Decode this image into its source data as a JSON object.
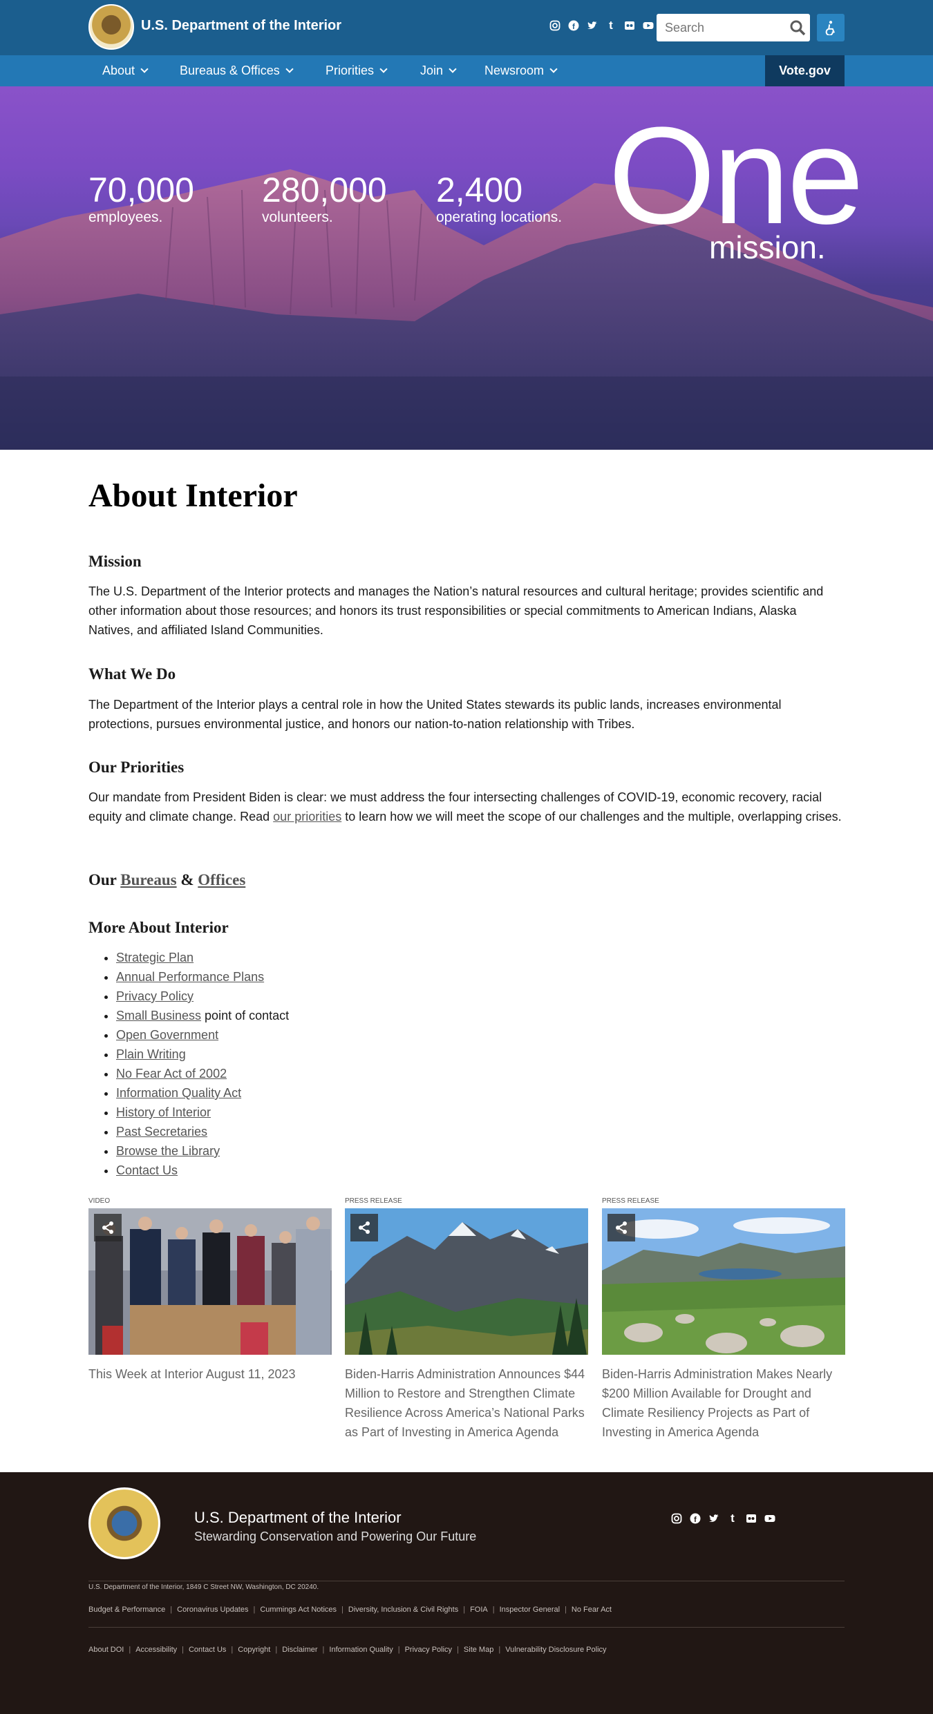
{
  "header": {
    "agency": "U.S. Department of the Interior",
    "search_placeholder": "Search",
    "social": [
      "instagram-icon",
      "facebook-icon",
      "twitter-icon",
      "tumblr-icon",
      "flickr-icon",
      "youtube-icon"
    ]
  },
  "nav": {
    "items": [
      "About",
      "Bureaus & Offices",
      "Priorities",
      "Join",
      "Newsroom"
    ],
    "vote": "Vote.gov"
  },
  "hero": {
    "stats": [
      {
        "num": "70,000",
        "label": "employees."
      },
      {
        "num": "280,000",
        "label": "volunteers."
      },
      {
        "num": "2,400",
        "label": "operating locations."
      }
    ],
    "one": "One",
    "mission": "mission."
  },
  "content": {
    "title": "About Interior",
    "mission_heading": "Mission",
    "mission_text": "The U.S. Department of the Interior protects and manages the Nation’s natural resources and cultural heritage; provides scientific and other information about those resources; and honors its trust responsibilities or special commitments to American Indians, Alaska Natives, and affiliated Island Communities.",
    "whatwedo_heading": "What We Do",
    "whatwedo_text": "The Department of the Interior plays a central role in how the United States stewards its public lands, increases environmental protections, pursues environmental justice, and honors our nation-to-nation relationship with Tribes.",
    "priorities_heading": "Our Priorities",
    "priorities_text_before": "Our mandate from President Biden is clear: we must address the four intersecting challenges of COVID-19, economic recovery, racial equity and climate change. Read ",
    "priorities_link": "our priorities",
    "priorities_text_after": " to learn how we will meet the scope of our challenges and the multiple, overlapping crises.",
    "bureaus_prefix": "Our ",
    "bureaus_link": "Bureaus",
    "bureaus_amp": " & ",
    "offices_link": "Offices",
    "more_heading": "More About Interior",
    "more_links": [
      {
        "link": "Strategic Plan",
        "suffix": ""
      },
      {
        "link": "Annual Performance Plans",
        "suffix": ""
      },
      {
        "link": "Privacy Policy",
        "suffix": ""
      },
      {
        "link": "Small Business",
        "suffix": " point of contact"
      },
      {
        "link": "Open Government",
        "suffix": ""
      },
      {
        "link": "Plain Writing ",
        "suffix": ""
      },
      {
        "link": "No Fear Act of 2002",
        "suffix": ""
      },
      {
        "link": "Information Quality Act",
        "suffix": ""
      },
      {
        "link": "History of Interior",
        "suffix": ""
      },
      {
        "link": "Past Secretaries",
        "suffix": ""
      },
      {
        "link": "Browse the Library",
        "suffix": ""
      },
      {
        "link": "Contact Us",
        "suffix": ""
      }
    ]
  },
  "cards": [
    {
      "type": "Video",
      "title": "This Week at Interior August 11, 2023"
    },
    {
      "type": "Press Release",
      "title": "Biden-Harris Administration Announces $44 Million to Restore and Strengthen Climate Resilience Across America’s National Parks as Part of Investing in America Agenda"
    },
    {
      "type": "Press Release",
      "title": "Biden-Harris Administration Makes Nearly $200 Million Available for Drought and Climate Resiliency Projects as Part of Investing in America Agenda"
    }
  ],
  "footer": {
    "name": "U.S. Department of the Interior",
    "tagline": "Stewarding Conservation and Powering Our Future",
    "links_row1": [
      "Budget & Performance",
      "Coronavirus Updates",
      "Cummings Act Notices",
      "Diversity, Inclusion & Civil Rights",
      "FOIA",
      "Inspector General",
      "No Fear Act"
    ],
    "links_row2": [
      "About DOI",
      "Accessibility",
      "Contact Us",
      "Copyright",
      "Disclaimer",
      "Information Quality",
      "Privacy Policy",
      "Site Map",
      "Vulnerability Disclosure Policy"
    ],
    "address": "U.S. Department of the Interior, 1849 C Street NW, Washington, DC 20240."
  },
  "colors": {
    "header": "#1b5e8e",
    "nav": "#2378b5",
    "vote": "#0f3a5f",
    "footer": "#211714"
  }
}
